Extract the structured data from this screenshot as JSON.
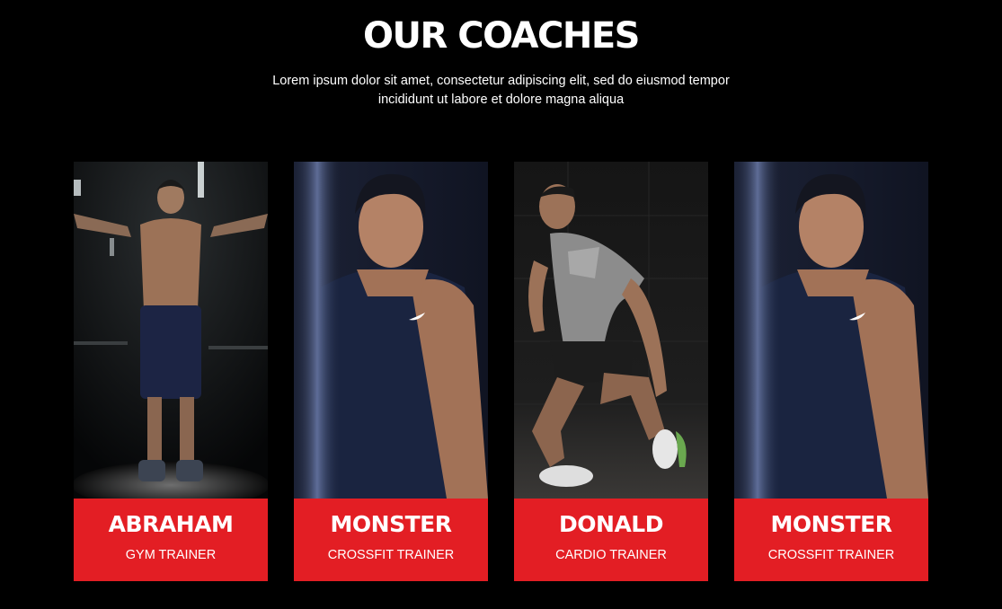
{
  "section": {
    "title": "OUR COACHES",
    "description": "Lorem ipsum dolor sit amet, consectetur adipiscing elit, sed do eiusmod tempor incididunt ut labore et dolore magna aliqua"
  },
  "colors": {
    "background": "#000000",
    "accent": "#e31e24",
    "text": "#ffffff"
  },
  "coaches": [
    {
      "name": "ABRAHAM",
      "role": "GYM TRAINER"
    },
    {
      "name": "MONSTER",
      "role": "CROSSFIT TRAINER"
    },
    {
      "name": "DONALD",
      "role": "CARDIO TRAINER"
    },
    {
      "name": "MONSTER",
      "role": "CROSSFIT TRAINER"
    }
  ]
}
